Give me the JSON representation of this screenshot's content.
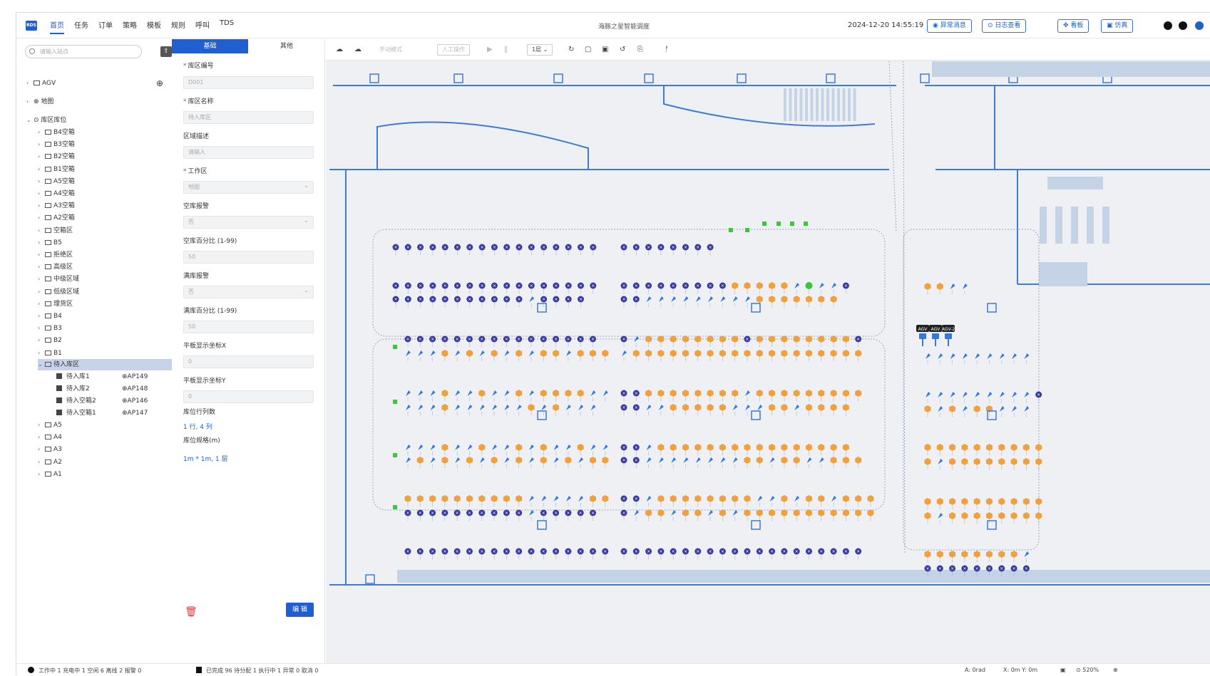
{
  "topbar": {
    "logo": "RDS",
    "menu": [
      "首页",
      "任务",
      "订单",
      "策略",
      "模板",
      "规则",
      "呼叫",
      "TDS"
    ],
    "title": "海豚之星智能调度",
    "datetime": "2024-12-20 14:55:19",
    "buttons": {
      "alarm": "异常消息",
      "log": "日志查看",
      "board": "看板",
      "sim": "仿真"
    }
  },
  "tree": {
    "search_placeholder": "请输入站点",
    "agv": "AGV",
    "map": "地图",
    "zones": "库区库位",
    "items": [
      "B4空箱",
      "B3空箱",
      "B2空箱",
      "B1空箱",
      "A5空箱",
      "A4空箱",
      "A3空箱",
      "A2空箱",
      "空箱区",
      "B5",
      "拒绝区",
      "高级区",
      "中级区域",
      "低级区域",
      "理货区",
      "B4",
      "B3",
      "B2",
      "B1"
    ],
    "selected": "待入库区",
    "children": [
      {
        "name": "待入库1",
        "code": "AP149"
      },
      {
        "name": "待入库2",
        "code": "AP148"
      },
      {
        "name": "待入空箱2",
        "code": "AP146"
      },
      {
        "name": "待入空箱1",
        "code": "AP147"
      }
    ],
    "after": [
      "A5",
      "A4",
      "A3",
      "A2",
      "A1"
    ]
  },
  "form": {
    "tabs": {
      "basic": "基础",
      "other": "其他"
    },
    "zone_code_label": "库区编号",
    "zone_code_value": "D001",
    "zone_name_label": "库区名称",
    "zone_name_value": "待入库区",
    "desc_label": "区域描述",
    "desc_placeholder": "请输入",
    "workarea_label": "工作区",
    "workarea_value": "地图",
    "empty_alarm_label": "空库报警",
    "empty_alarm_value": "否",
    "empty_pct_label": "空库百分比 (1-99)",
    "empty_pct_value": "50",
    "full_alarm_label": "满库报警",
    "full_alarm_value": "否",
    "full_pct_label": "满库百分比 (1-99)",
    "full_pct_value": "50",
    "coord_x_label": "平板显示坐标X",
    "coord_x_value": "0",
    "coord_y_label": "平板显示坐标Y",
    "coord_y_value": "0",
    "rowcol_label": "库位行列数",
    "rowcol_value": "1 行, 4 列",
    "size_label": "库位规格(m)",
    "size_value": "1m * 1m, 1 层",
    "edit": "编 辑"
  },
  "maptoolbar": {
    "mode": "手动模式",
    "manual": "人工操作",
    "floor": "1层"
  },
  "map": {
    "agv_labels": [
      "AGV",
      "AGV",
      "AGV-2"
    ]
  },
  "status": {
    "agents": "工作中 1   充电中 1   空闲 6   离线 2   报警 0",
    "tasks": "已完成 96   待分配 1   执行中 1   异常 0   取消 0",
    "angle": "A: 0rad",
    "coords": "X: 0m   Y: 0m",
    "zoom": "520%"
  },
  "colors": {
    "accent": "#1f5fd1",
    "full": "#f0a03c",
    "empty": "#3a3a9e",
    "agv": "#3579e0",
    "charge": "#3cc63c"
  }
}
